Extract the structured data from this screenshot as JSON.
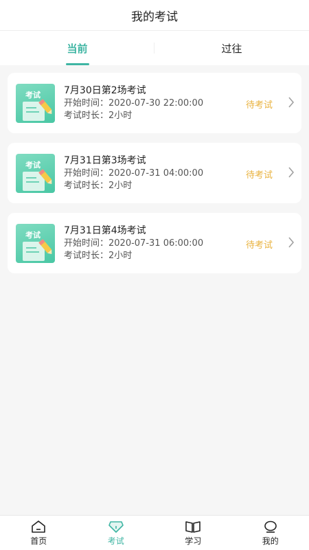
{
  "header": {
    "title": "我的考试"
  },
  "tabs": [
    {
      "label": "当前",
      "active": true
    },
    {
      "label": "过往",
      "active": false
    }
  ],
  "exams": [
    {
      "title": "7月30日第2场考试",
      "start_label": "开始时间：",
      "start_value": "2020-07-30 22:00:00",
      "duration_label": "考试时长：",
      "duration_value": "2小时",
      "status": "待考试",
      "thumb_label": "考试"
    },
    {
      "title": "7月31日第3场考试",
      "start_label": "开始时间：",
      "start_value": "2020-07-31 04:00:00",
      "duration_label": "考试时长：",
      "duration_value": "2小时",
      "status": "待考试",
      "thumb_label": "考试"
    },
    {
      "title": "7月31日第4场考试",
      "start_label": "开始时间：",
      "start_value": "2020-07-31 06:00:00",
      "duration_label": "考试时长：",
      "duration_value": "2小时",
      "status": "待考试",
      "thumb_label": "考试"
    }
  ],
  "bottom_nav": [
    {
      "label": "首页",
      "icon": "home-icon",
      "active": false
    },
    {
      "label": "考试",
      "icon": "diamond-icon",
      "active": true
    },
    {
      "label": "学习",
      "icon": "book-icon",
      "active": false
    },
    {
      "label": "我的",
      "icon": "user-icon",
      "active": false
    }
  ],
  "colors": {
    "accent": "#3fb5a3",
    "status": "#e9b23e",
    "thumb": "#49c7a4"
  }
}
